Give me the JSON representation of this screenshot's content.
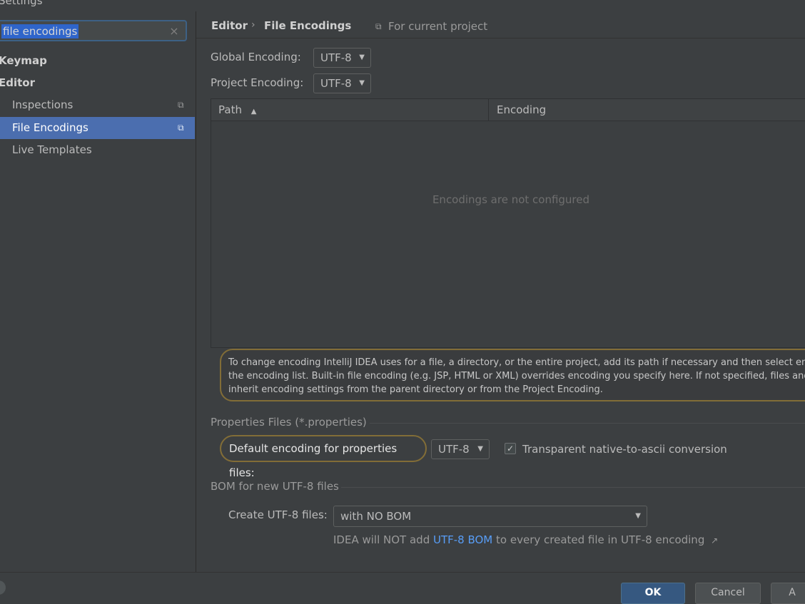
{
  "window": {
    "title": "Settings"
  },
  "search": {
    "value": "file encodings",
    "clear_icon": "×"
  },
  "sidebar": {
    "groups": [
      {
        "label": "Keymap"
      },
      {
        "label": "Editor"
      }
    ],
    "items": [
      {
        "label": "Inspections",
        "icon": "copy-icon"
      },
      {
        "label": "File Encodings",
        "icon": "copy-icon",
        "selected": true
      },
      {
        "label": "Live Templates"
      }
    ]
  },
  "breadcrumb": {
    "parent": "Editor",
    "separator": "›",
    "current": "File Encodings",
    "scope": "For current project",
    "scope_icon": "⧉"
  },
  "global_encoding": {
    "label": "Global Encoding:",
    "value": "UTF-8"
  },
  "project_encoding": {
    "label": "Project Encoding:",
    "value": "UTF-8"
  },
  "table": {
    "columns": [
      {
        "label": "Path",
        "sort": "▲"
      },
      {
        "label": "Encoding"
      }
    ],
    "empty_text": "Encodings are not configured"
  },
  "info_text": {
    "line1": "To change encoding IntelliJ IDEA uses for a file, a directory, or the entire project, add its path if necessary and then select encoding",
    "line2": "the encoding list. Built-in file encoding (e.g. JSP, HTML or XML) overrides encoding you specify here. If not specified, files and direct",
    "line3": "inherit encoding settings from the parent directory or from the Project Encoding."
  },
  "properties": {
    "section_title": "Properties Files (*.properties)",
    "default_label": "Default encoding for properties files:",
    "default_value": "UTF-8",
    "transparent_label": "Transparent native-to-ascii conversion",
    "transparent_checked": true
  },
  "bom": {
    "section_title": "BOM for new UTF-8 files",
    "create_label": "Create UTF-8 files:",
    "create_value": "with NO BOM",
    "hint_prefix": "IDEA will NOT add ",
    "hint_link": "UTF-8 BOM",
    "hint_suffix": " to every created file in UTF-8 encoding",
    "hint_icon": "↗"
  },
  "buttons": {
    "ok": "OK",
    "cancel": "Cancel",
    "apply": "A"
  },
  "colors": {
    "accent": "#4b6eaf",
    "highlight_oval": "#826d37",
    "link": "#589df6"
  }
}
